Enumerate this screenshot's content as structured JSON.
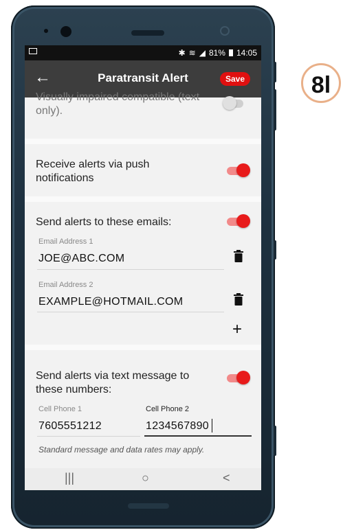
{
  "status": {
    "battery_percent": "81%",
    "time": "14:05"
  },
  "appbar": {
    "back_glyph": "←",
    "title": "Paratransit Alert",
    "save_label": "Save"
  },
  "visually_impaired": {
    "label": "Visually impaired compatible (text only).",
    "enabled": false
  },
  "push": {
    "label": "Receive alerts via push notifications",
    "enabled": true
  },
  "emails": {
    "label": "Send alerts to these emails:",
    "enabled": true,
    "items": [
      {
        "field_label": "Email Address 1",
        "value": "JOE@ABC.COM"
      },
      {
        "field_label": "Email Address 2",
        "value": "EXAMPLE@HOTMAIL.COM"
      }
    ],
    "add_glyph": "+"
  },
  "sms": {
    "label": "Send alerts via text message to these numbers:",
    "enabled": true,
    "phones": [
      {
        "field_label": "Cell Phone 1",
        "value": "7605551212"
      },
      {
        "field_label": "Cell Phone 2",
        "value": "1234567890"
      }
    ],
    "note": "Standard message and data rates may apply."
  },
  "navbar": {
    "recent_glyph": "|||",
    "home_glyph": "○",
    "back_glyph": "<"
  },
  "badge": {
    "text": "8l"
  },
  "colors": {
    "accent": "#e81b1b",
    "appbar": "#3d3d3d",
    "badge_border": "#e9b089"
  }
}
